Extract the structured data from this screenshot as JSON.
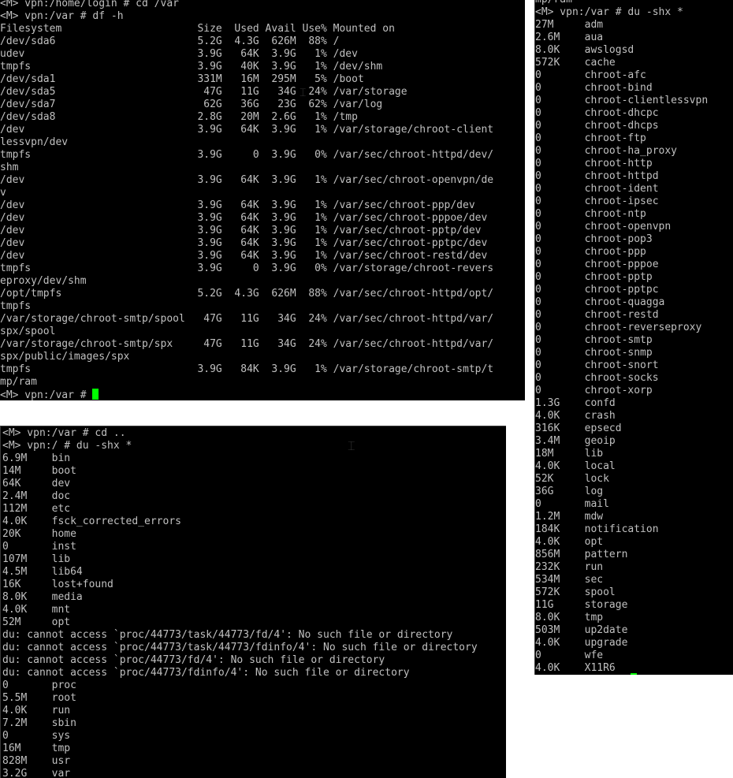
{
  "terminal_df": {
    "lines": [
      "<M> vpn:/home/login # cd /var",
      "<M> vpn:/var # df -h",
      "Filesystem                      Size  Used Avail Use% Mounted on",
      "/dev/sda6                       5.2G  4.3G  626M  88% /",
      "udev                            3.9G   64K  3.9G   1% /dev",
      "tmpfs                           3.9G   40K  3.9G   1% /dev/shm",
      "/dev/sda1                       331M   16M  295M   5% /boot",
      "/dev/sda5                        47G   11G   34G  24% /var/storage",
      "/dev/sda7                        62G   36G   23G  62% /var/log",
      "/dev/sda8                       2.8G   20M  2.6G   1% /tmp",
      "/dev                            3.9G   64K  3.9G   1% /var/storage/chroot-client",
      "lessvpn/dev",
      "tmpfs                           3.9G     0  3.9G   0% /var/sec/chroot-httpd/dev/",
      "shm",
      "/dev                            3.9G   64K  3.9G   1% /var/sec/chroot-openvpn/de",
      "v",
      "/dev                            3.9G   64K  3.9G   1% /var/sec/chroot-ppp/dev",
      "/dev                            3.9G   64K  3.9G   1% /var/sec/chroot-pppoe/dev",
      "/dev                            3.9G   64K  3.9G   1% /var/sec/chroot-pptp/dev",
      "/dev                            3.9G   64K  3.9G   1% /var/sec/chroot-pptpc/dev",
      "/dev                            3.9G   64K  3.9G   1% /var/sec/chroot-restd/dev",
      "tmpfs                           3.9G     0  3.9G   0% /var/storage/chroot-revers",
      "eproxy/dev/shm",
      "/opt/tmpfs                      5.2G  4.3G  626M  88% /var/sec/chroot-httpd/opt/",
      "tmpfs",
      "/var/storage/chroot-smtp/spool   47G   11G   34G  24% /var/sec/chroot-httpd/var/",
      "spx/spool",
      "/var/storage/chroot-smtp/spx     47G   11G   34G  24% /var/sec/chroot-httpd/var/",
      "spx/public/images/spx",
      "tmpfs                           3.9G   84K  3.9G   1% /var/storage/chroot-smtp/t",
      "mp/ram"
    ],
    "prompt": "<M> vpn:/var # "
  },
  "terminal_du_var": {
    "lines": [
      "mp/ram",
      "<M> vpn:/var # du -shx *",
      "27M     adm",
      "2.6M    aua",
      "8.0K    awslogsd",
      "572K    cache",
      "0       chroot-afc",
      "0       chroot-bind",
      "0       chroot-clientlessvpn",
      "0       chroot-dhcpc",
      "0       chroot-dhcps",
      "0       chroot-ftp",
      "0       chroot-ha_proxy",
      "0       chroot-http",
      "0       chroot-httpd",
      "0       chroot-ident",
      "0       chroot-ipsec",
      "0       chroot-ntp",
      "0       chroot-openvpn",
      "0       chroot-pop3",
      "0       chroot-ppp",
      "0       chroot-pppoe",
      "0       chroot-pptp",
      "0       chroot-pptpc",
      "0       chroot-quagga",
      "0       chroot-restd",
      "0       chroot-reverseproxy",
      "0       chroot-smtp",
      "0       chroot-snmp",
      "0       chroot-snort",
      "0       chroot-socks",
      "0       chroot-xorp",
      "1.3G    confd",
      "4.0K    crash",
      "316K    epsecd",
      "3.4M    geoip",
      "18M     lib",
      "4.0K    local",
      "52K     lock",
      "36G     log",
      "0       mail",
      "1.2M    mdw",
      "184K    notification",
      "4.0K    opt",
      "856M    pattern",
      "232K    run",
      "534M    sec",
      "572K    spool",
      "11G     storage",
      "8.0K    tmp",
      "503M    up2date",
      "4.0K    upgrade",
      "0       wfe",
      "4.0K    X11R6"
    ]
  },
  "terminal_du_root": {
    "lines": [
      "<M> vpn:/var # cd ..",
      "<M> vpn:/ # du -shx *",
      "6.9M    bin",
      "14M     boot",
      "64K     dev",
      "2.4M    doc",
      "112M    etc",
      "4.0K    fsck_corrected_errors",
      "20K     home",
      "0       inst",
      "107M    lib",
      "4.5M    lib64",
      "16K     lost+found",
      "8.0K    media",
      "4.0K    mnt",
      "52M     opt",
      "du: cannot access `proc/44773/task/44773/fd/4': No such file or directory",
      "du: cannot access `proc/44773/task/44773/fdinfo/4': No such file or directory",
      "du: cannot access `proc/44773/fd/4': No such file or directory",
      "du: cannot access `proc/44773/fdinfo/4': No such file or directory",
      "0       proc",
      "5.5M    root",
      "4.0K    run",
      "7.2M    sbin",
      "0       sys",
      "16M     tmp",
      "828M    usr",
      "3.2G    var"
    ]
  },
  "colors": {
    "terminal_bg": "#000000",
    "terminal_fg": "#c0c0c0",
    "cursor": "#00ff00",
    "page_bg": "#ffffff"
  }
}
